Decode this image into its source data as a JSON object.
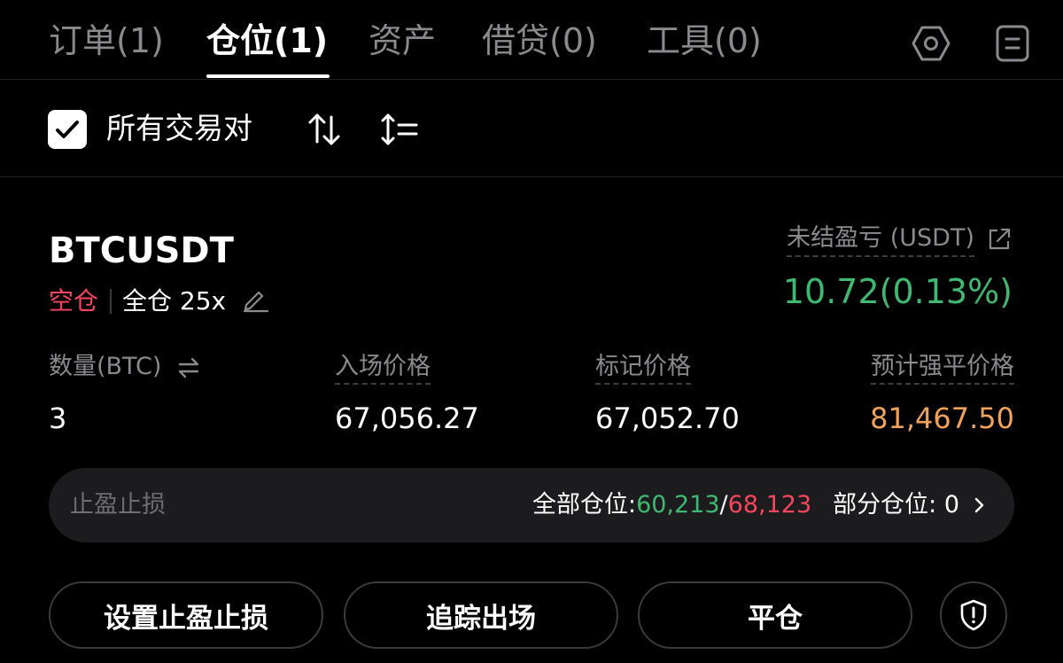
{
  "tabs": [
    {
      "label": "订单(1)"
    },
    {
      "label": "仓位(1)"
    },
    {
      "label": "资产"
    },
    {
      "label": "借贷(0)"
    },
    {
      "label": "工具(0)"
    }
  ],
  "active_tab": "仓位(1)",
  "filter": {
    "all_pairs_label": "所有交易对",
    "checked": true
  },
  "position": {
    "symbol": "BTCUSDT",
    "side": "空仓",
    "margin_mode": "全仓 25x",
    "pnl_label": "未结盈亏 (USDT)",
    "pnl_value": "10.72(0.13%)",
    "columns": [
      {
        "label": "数量(BTC)",
        "value": "3"
      },
      {
        "label": "入场价格",
        "value": "67,056.27"
      },
      {
        "label": "标记价格",
        "value": "67,052.70"
      },
      {
        "label": "预计强平价格",
        "value": "81,467.50"
      }
    ]
  },
  "tpsl": {
    "title": "止盈止损",
    "full_label": "全部仓位: ",
    "tp_price": "60,213",
    "separator": "/",
    "sl_price": "68,123",
    "partial_label": "部分仓位: 0"
  },
  "actions": {
    "set_tpsl": "设置止盈止损",
    "trailing_exit": "追踪出场",
    "close_position": "平仓"
  },
  "colors": {
    "profit": "#3fb871",
    "loss": "#f6465d",
    "liquidation": "#f0a25a",
    "muted": "#8a8a8e"
  },
  "icons": [
    "settings-hexagon-icon",
    "document-list-icon",
    "checkmark-icon",
    "sort-arrows-icon",
    "sort-list-icon",
    "edit-pencil-icon",
    "share-external-icon",
    "swap-icon",
    "chevron-right-icon",
    "shield-alert-icon"
  ]
}
